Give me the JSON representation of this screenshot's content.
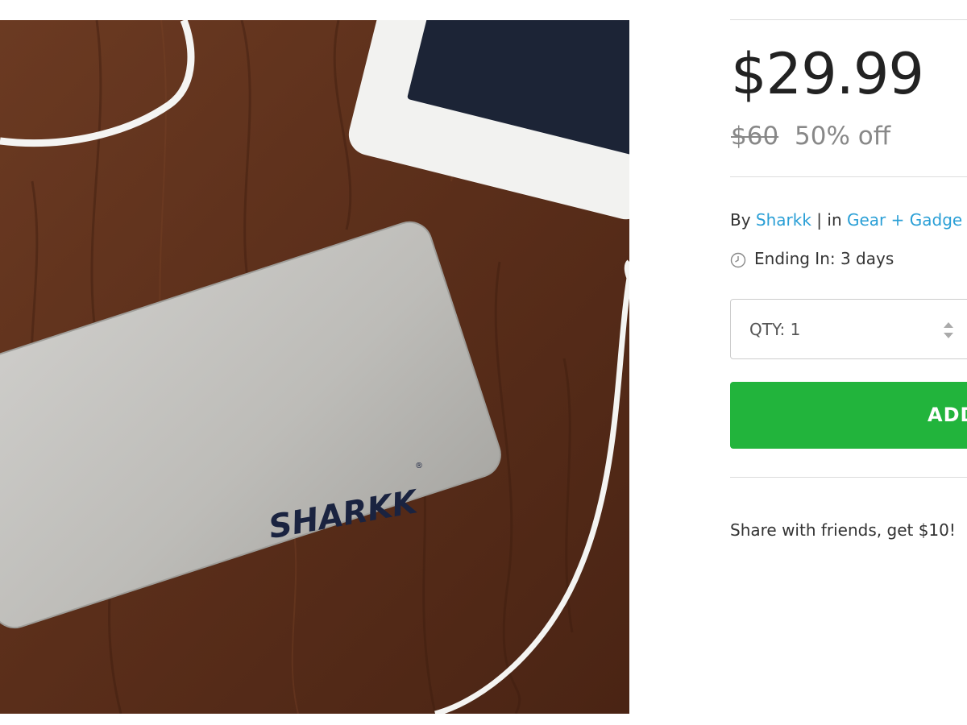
{
  "product": {
    "image_brand_text": "SHARKK",
    "price": "$29.99",
    "original_price": "$60",
    "discount": "50% off",
    "by_label": "By",
    "vendor": "Sharkk",
    "separator": "|",
    "in_label": "in",
    "category": "Gear + Gadge",
    "ending_label": "Ending In: 3 days",
    "quantity_label": "QTY: 1",
    "add_button_label": "ADD",
    "share_text": "Share with friends, get $10!"
  },
  "icons": {
    "clock": "clock-icon",
    "stepper": "up-down-stepper-icon"
  },
  "colors": {
    "price_text": "#222222",
    "muted_text": "#888888",
    "link": "#2a9fd6",
    "add_button": "#22b43c",
    "divider": "#dcdcdc"
  }
}
